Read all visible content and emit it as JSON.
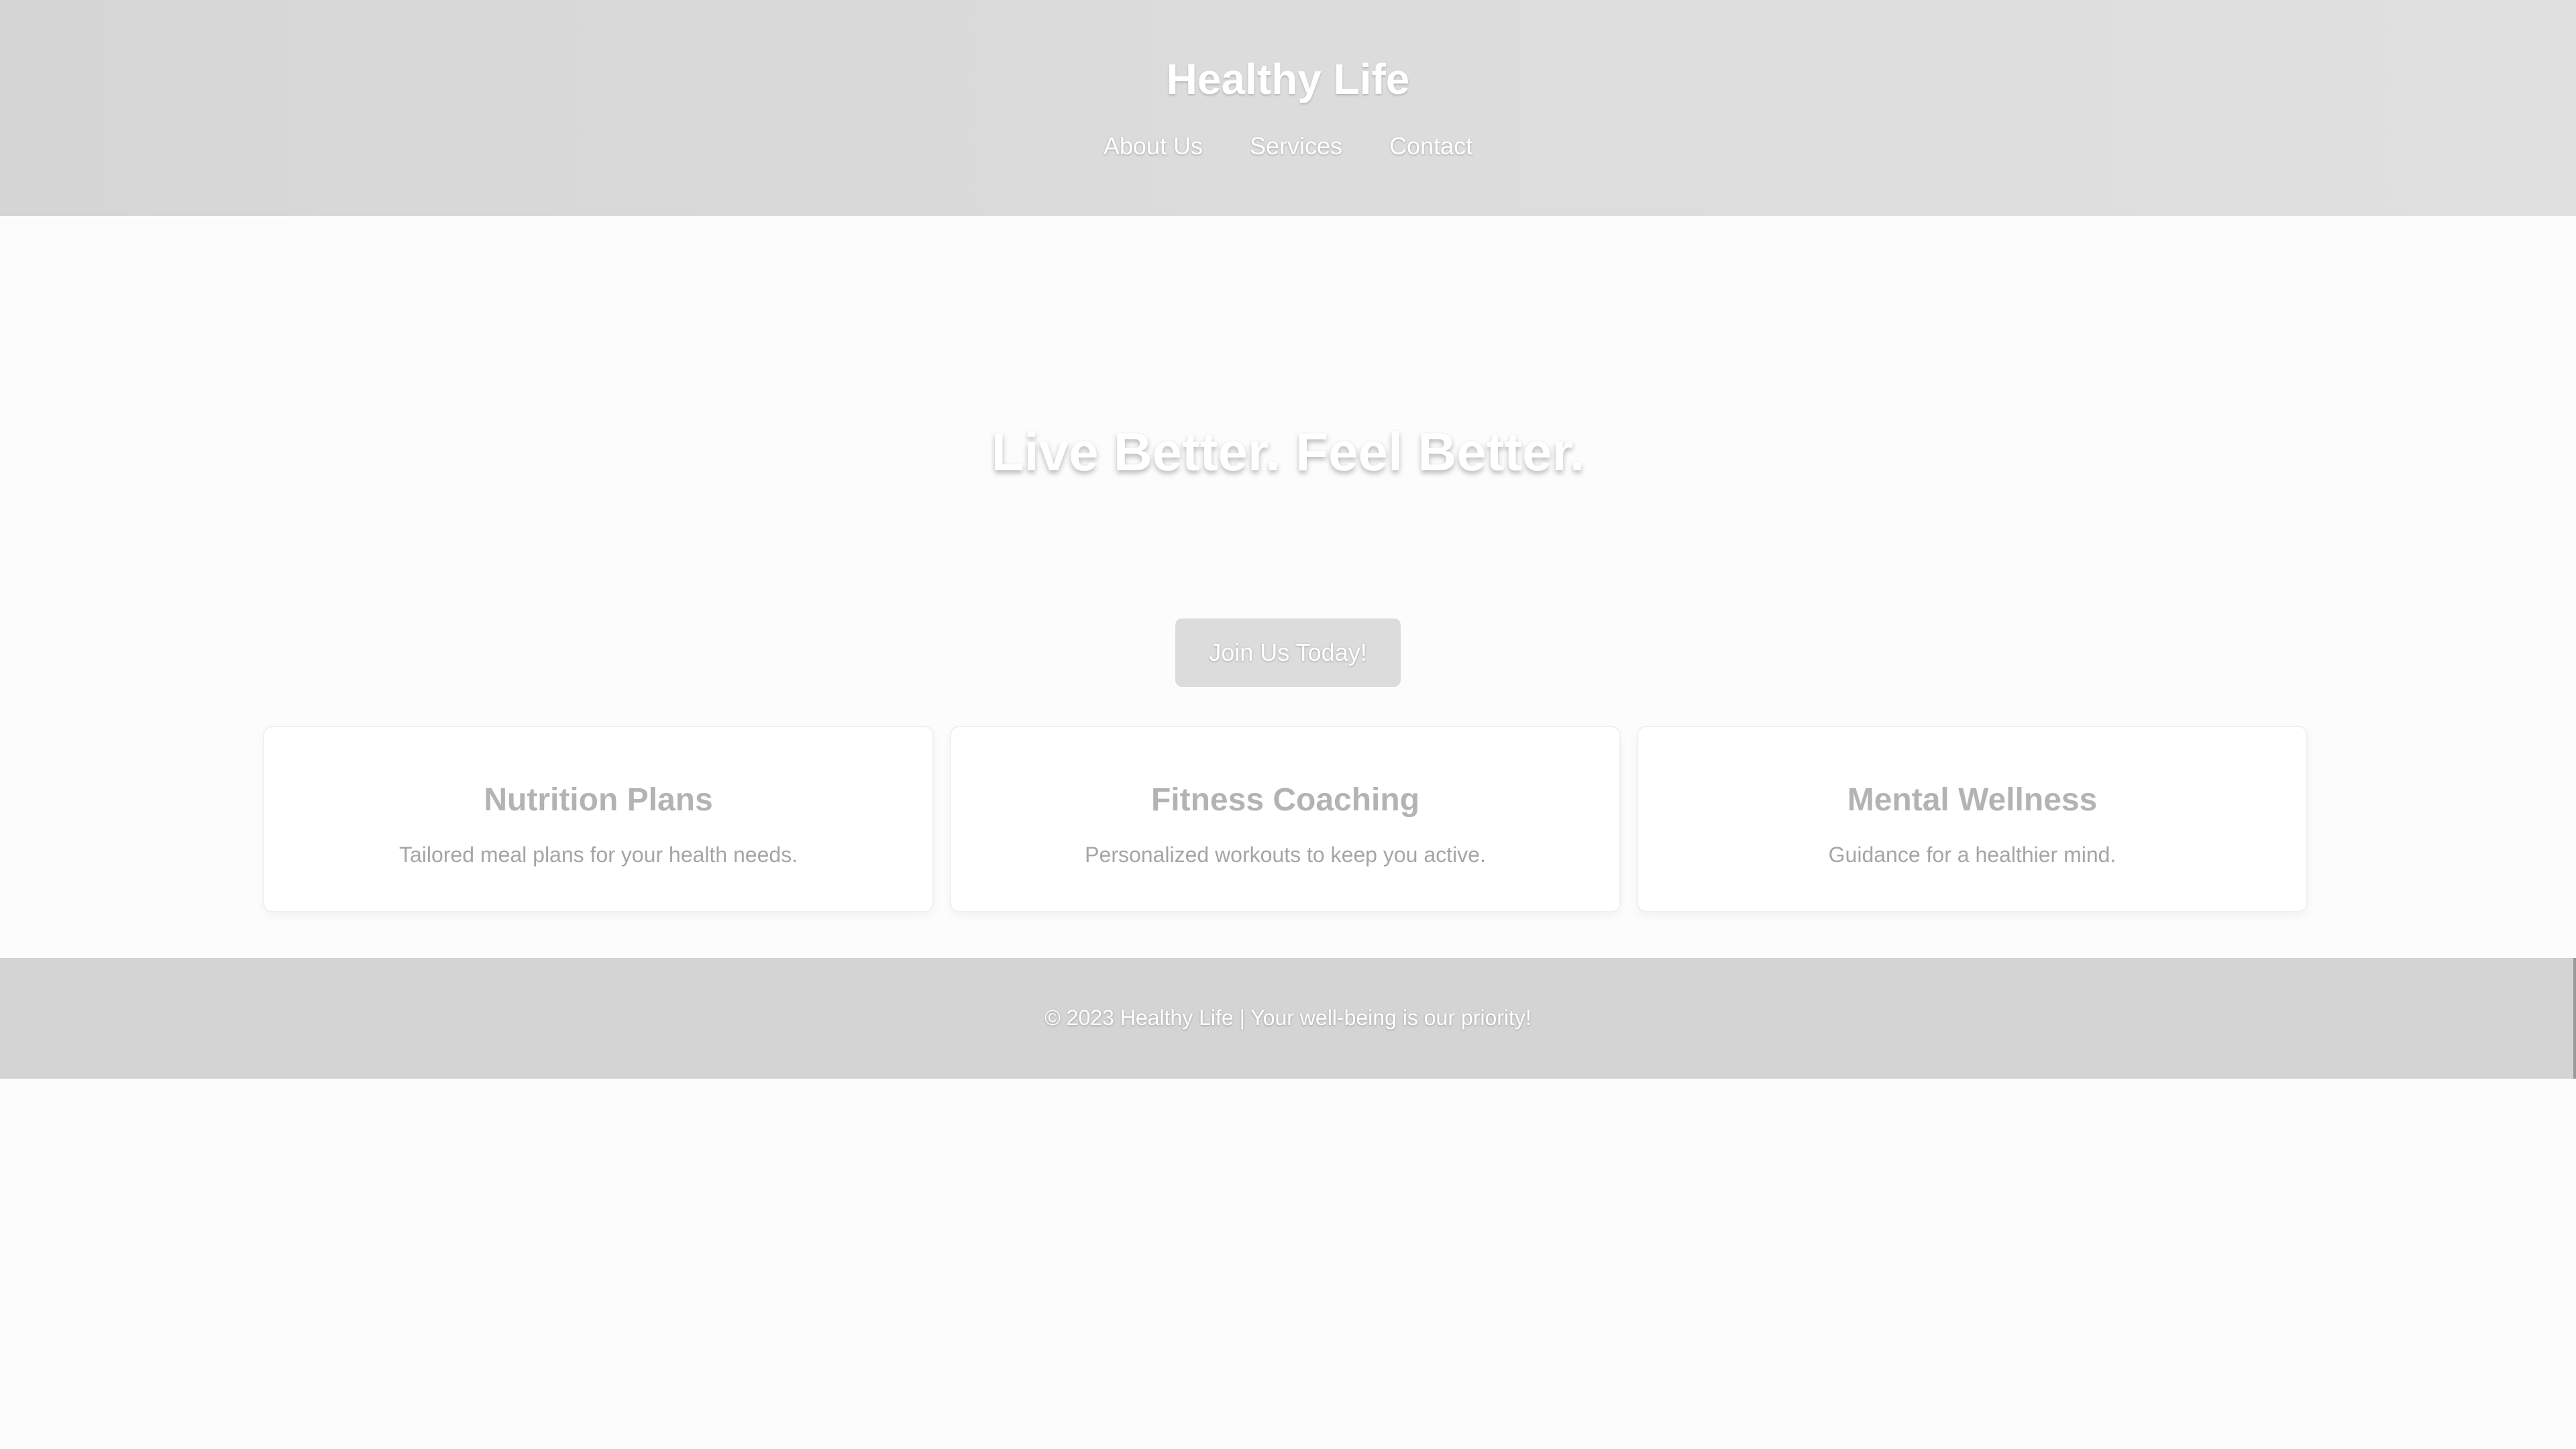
{
  "header": {
    "site_title": "Healthy Life",
    "nav": [
      {
        "label": "About Us"
      },
      {
        "label": "Services"
      },
      {
        "label": "Contact"
      }
    ]
  },
  "hero": {
    "title": "Live Better. Feel Better.",
    "cta_label": "Join Us Today!"
  },
  "cards": [
    {
      "title": "Nutrition Plans",
      "text": "Tailored meal plans for your health needs."
    },
    {
      "title": "Fitness Coaching",
      "text": "Personalized workouts to keep you active."
    },
    {
      "title": "Mental Wellness",
      "text": "Guidance for a healthier mind."
    }
  ],
  "footer": {
    "text": "© 2023 Healthy Life | Your well-being is our priority!"
  },
  "colors": {
    "header_bg": "#dcdcdc",
    "page_bg": "#fcfcfc",
    "footer_bg": "#d4d4d4",
    "button_bg": "#dcdcdc"
  }
}
